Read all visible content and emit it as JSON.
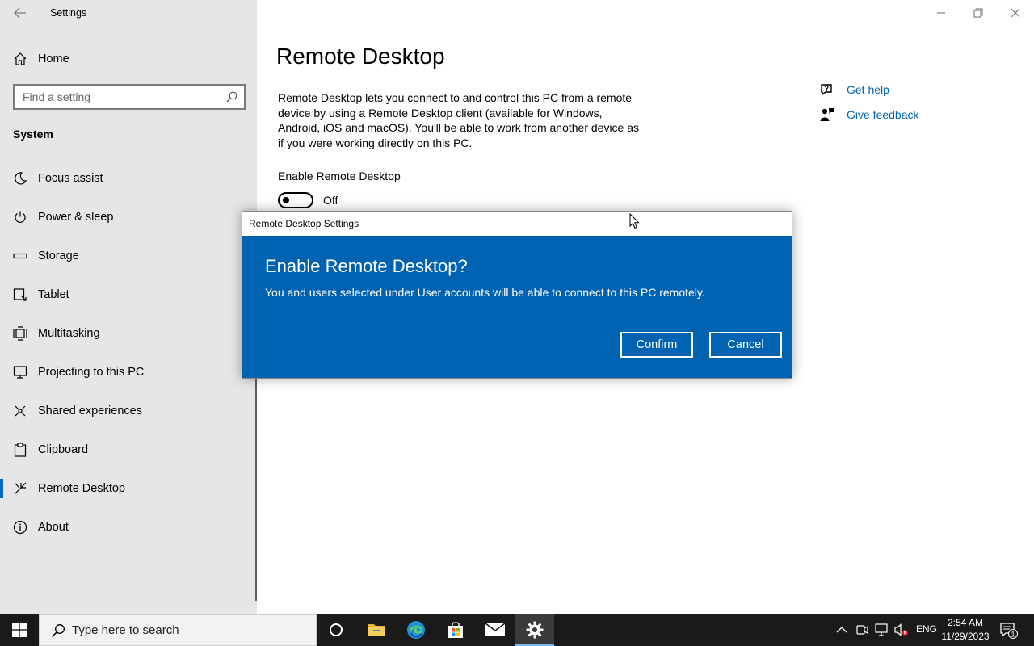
{
  "window": {
    "title": "Settings"
  },
  "sidebar": {
    "home_label": "Home",
    "search_placeholder": "Find a setting",
    "section_title": "System",
    "items": [
      {
        "label": "Focus assist",
        "icon": "moon-icon"
      },
      {
        "label": "Power & sleep",
        "icon": "power-icon"
      },
      {
        "label": "Storage",
        "icon": "storage-icon"
      },
      {
        "label": "Tablet",
        "icon": "tablet-icon"
      },
      {
        "label": "Multitasking",
        "icon": "multitasking-icon"
      },
      {
        "label": "Projecting to this PC",
        "icon": "projecting-icon"
      },
      {
        "label": "Shared experiences",
        "icon": "shared-experiences-icon"
      },
      {
        "label": "Clipboard",
        "icon": "clipboard-icon"
      },
      {
        "label": "Remote Desktop",
        "icon": "remote-desktop-icon",
        "selected": true
      },
      {
        "label": "About",
        "icon": "info-icon"
      }
    ]
  },
  "main": {
    "title": "Remote Desktop",
    "description": "Remote Desktop lets you connect to and control this PC from a remote device by using a Remote Desktop client (available for Windows, Android, iOS and macOS). You'll be able to work from another device as if you were working directly on this PC.",
    "toggle_label": "Enable Remote Desktop",
    "toggle_state": "Off",
    "help_links": {
      "get_help": "Get help",
      "give_feedback": "Give feedback"
    }
  },
  "dialog": {
    "title": "Remote Desktop Settings",
    "heading": "Enable Remote Desktop?",
    "message": "You and users selected under User accounts will be able to connect to this PC remotely.",
    "confirm_label": "Confirm",
    "cancel_label": "Cancel"
  },
  "taskbar": {
    "search_placeholder": "Type here to search",
    "language": "ENG",
    "time": "2:54 AM",
    "date": "11/29/2023",
    "notification_count": "1"
  },
  "colors": {
    "accent": "#0063b1",
    "selected_indicator": "#0067c0",
    "link": "#0063b1",
    "sidebar_bg": "#e6e6e6",
    "taskbar_bg": "#1a1a1a"
  }
}
